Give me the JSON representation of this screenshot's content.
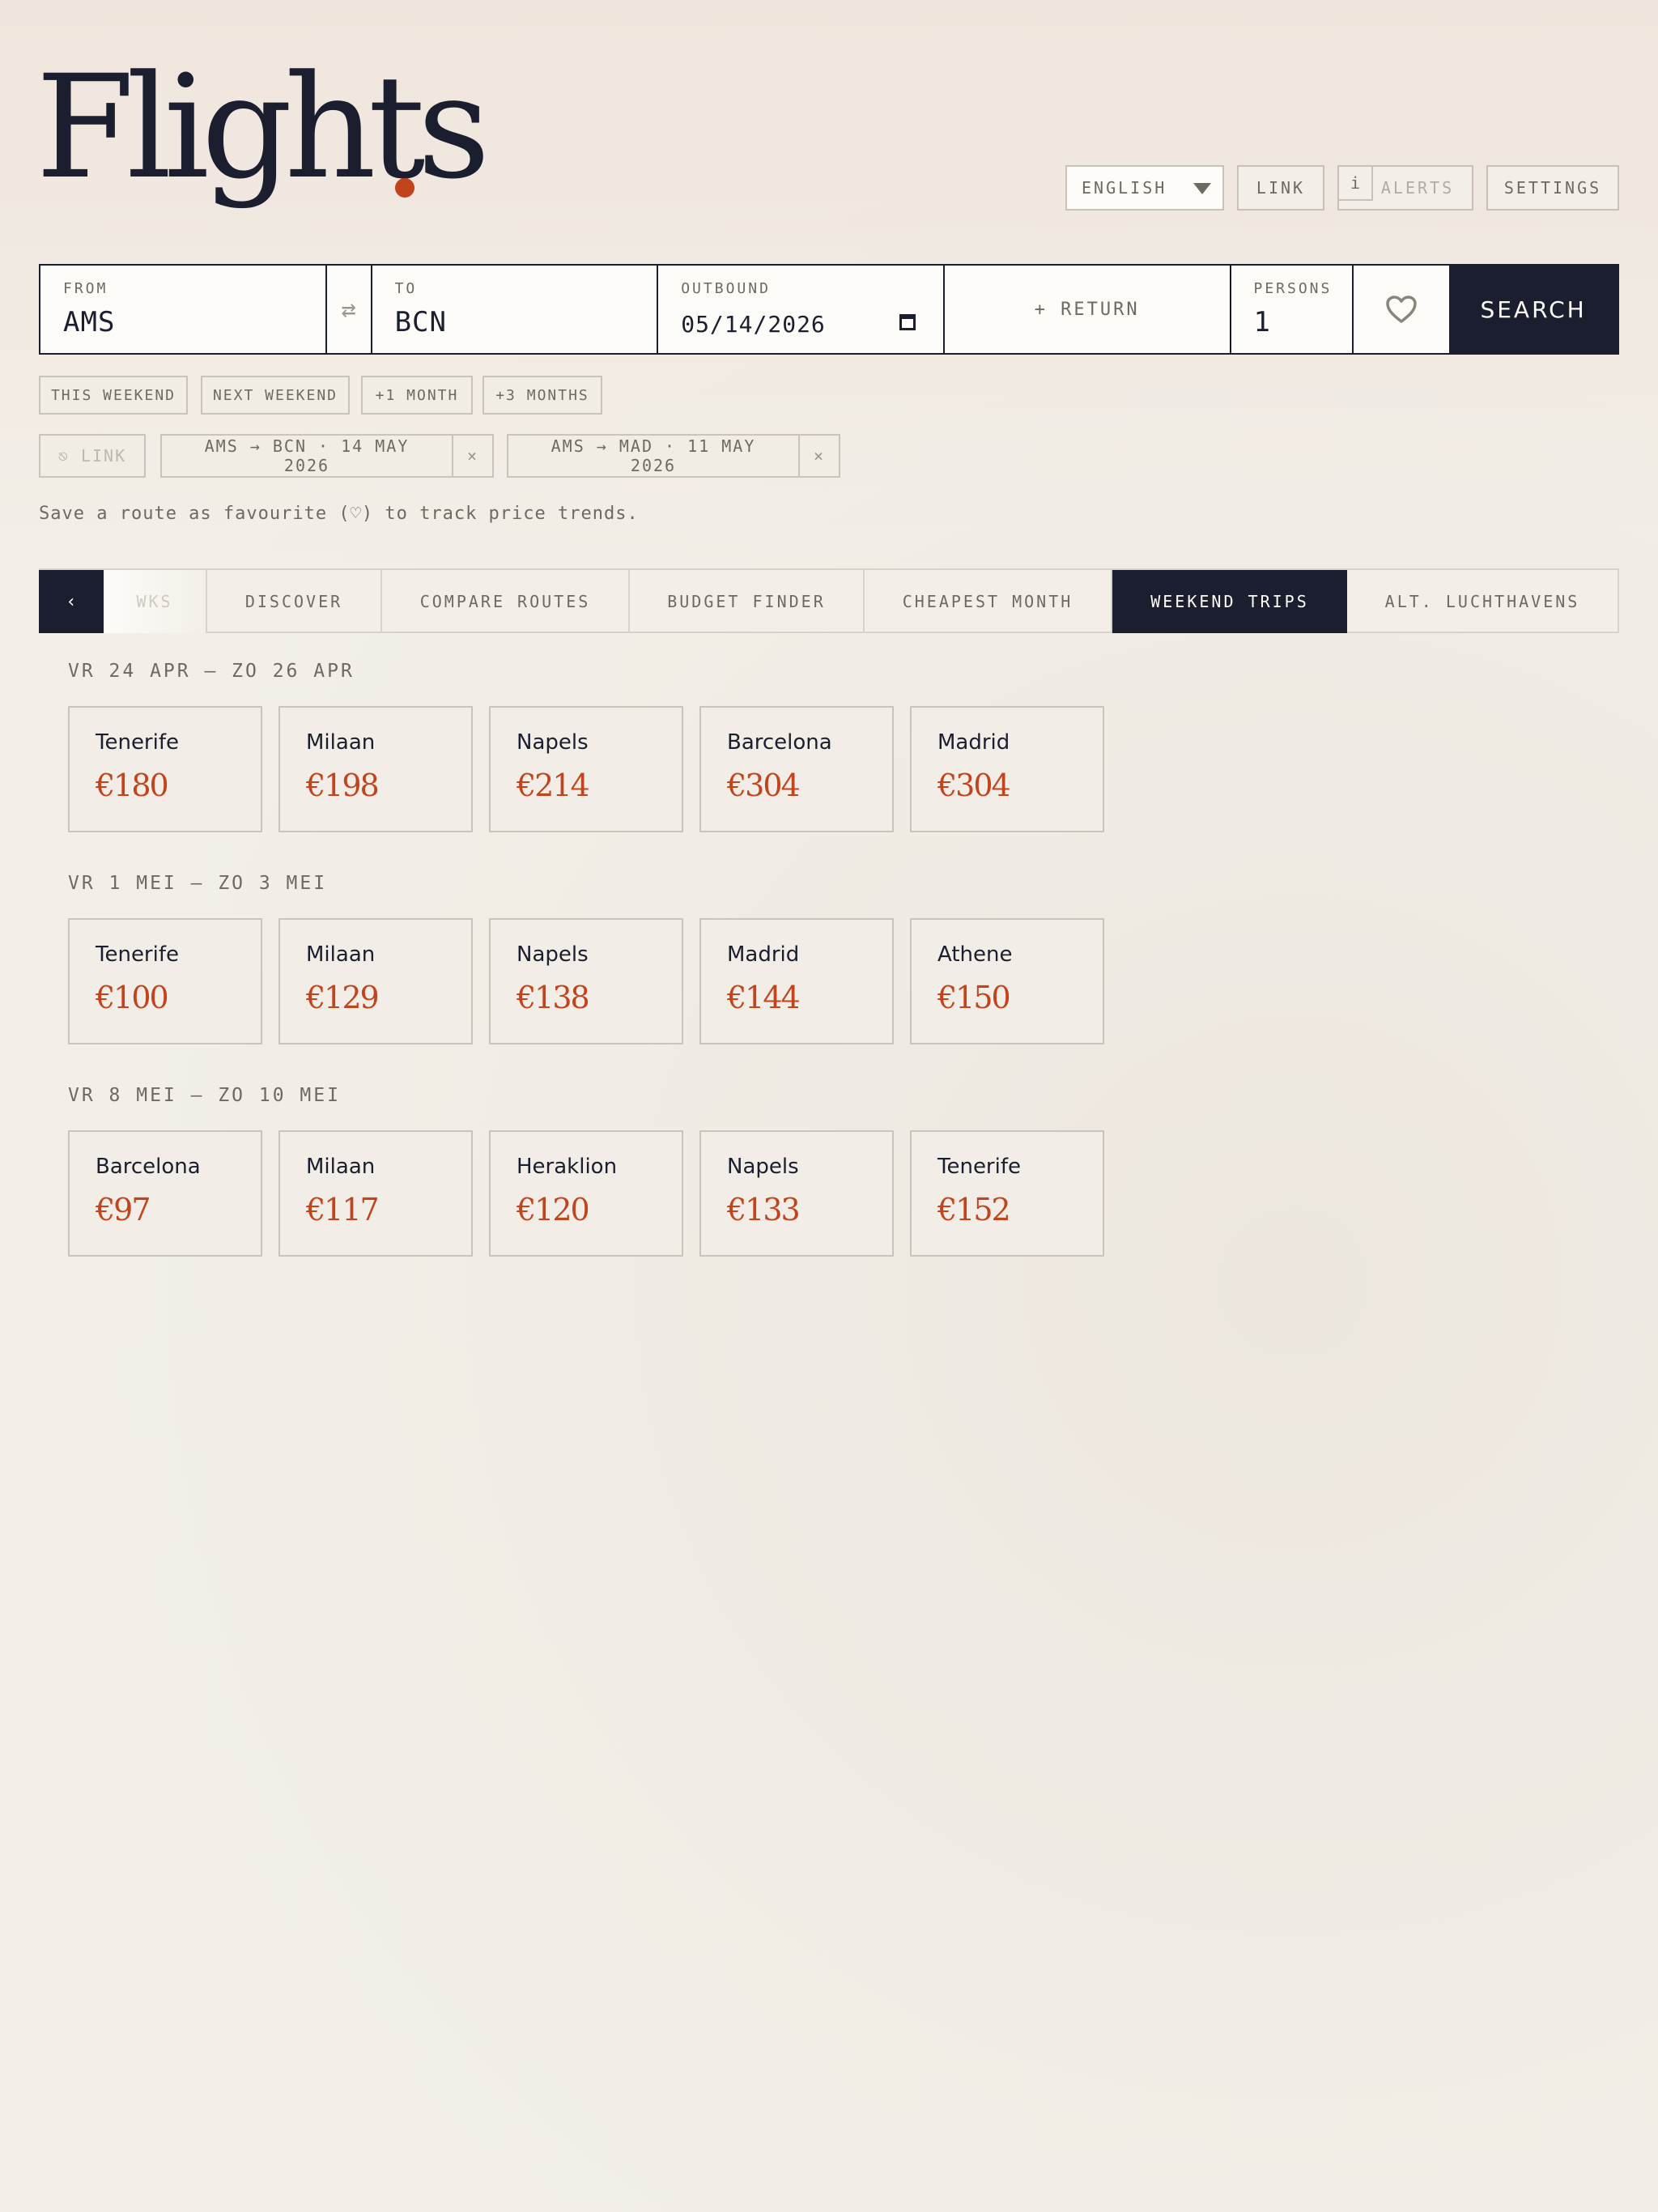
{
  "logo": {
    "text": "Flights"
  },
  "top_controls": {
    "language": "ENGLISH",
    "link": "LINK",
    "alerts_badge": "i",
    "alerts": "ALERTS",
    "settings": "SETTINGS"
  },
  "search": {
    "from_label": "FROM",
    "from_value": "AMS",
    "swap_icon": "⇄",
    "to_label": "TO",
    "to_value": "BCN",
    "outbound_label": "OUTBOUND",
    "outbound_value": "05/14/2026",
    "return_label": "+ RETURN",
    "persons_label": "PERSONS",
    "persons_value": "1",
    "search_label": "SEARCH"
  },
  "quick_ranges": [
    "THIS WEEKEND",
    "NEXT WEEKEND",
    "+1 MONTH",
    "+3 MONTHS"
  ],
  "saved": {
    "link_label": "⎋ LINK",
    "routes": [
      {
        "label": "AMS → BCN · 14 MAY 2026",
        "remove": "×"
      },
      {
        "label": "AMS → MAD · 11 MAY 2026",
        "remove": "×"
      }
    ]
  },
  "hint": "Save a route as favourite (♡) to track price trends.",
  "tabs": {
    "prev": "‹",
    "items": [
      "WKS",
      "DISCOVER",
      "COMPARE ROUTES",
      "BUDGET FINDER",
      "CHEAPEST MONTH",
      "WEEKEND TRIPS",
      "ALT. LUCHTHAVENS"
    ],
    "active": "WEEKEND TRIPS"
  },
  "weekends": [
    {
      "title": "VR 24 APR — ZO 26 APR",
      "trips": [
        {
          "city": "Tenerife",
          "price": "€180"
        },
        {
          "city": "Milaan",
          "price": "€198"
        },
        {
          "city": "Napels",
          "price": "€214"
        },
        {
          "city": "Barcelona",
          "price": "€304"
        },
        {
          "city": "Madrid",
          "price": "€304"
        }
      ]
    },
    {
      "title": "VR 1 MEI — ZO 3 MEI",
      "trips": [
        {
          "city": "Tenerife",
          "price": "€100"
        },
        {
          "city": "Milaan",
          "price": "€129"
        },
        {
          "city": "Napels",
          "price": "€138"
        },
        {
          "city": "Madrid",
          "price": "€144"
        },
        {
          "city": "Athene",
          "price": "€150"
        }
      ]
    },
    {
      "title": "VR 8 MEI — ZO 10 MEI",
      "trips": [
        {
          "city": "Barcelona",
          "price": "€97"
        },
        {
          "city": "Milaan",
          "price": "€117"
        },
        {
          "city": "Heraklion",
          "price": "€120"
        },
        {
          "city": "Napels",
          "price": "€133"
        },
        {
          "city": "Tenerife",
          "price": "€152"
        }
      ]
    }
  ],
  "colors": {
    "ink": "#1b1e2e",
    "accent": "#c2441c",
    "paper": "#f2eee7"
  },
  "icons": {
    "favourite": "heart-icon",
    "calendar": "calendar-icon",
    "swap": "swap-icon"
  }
}
